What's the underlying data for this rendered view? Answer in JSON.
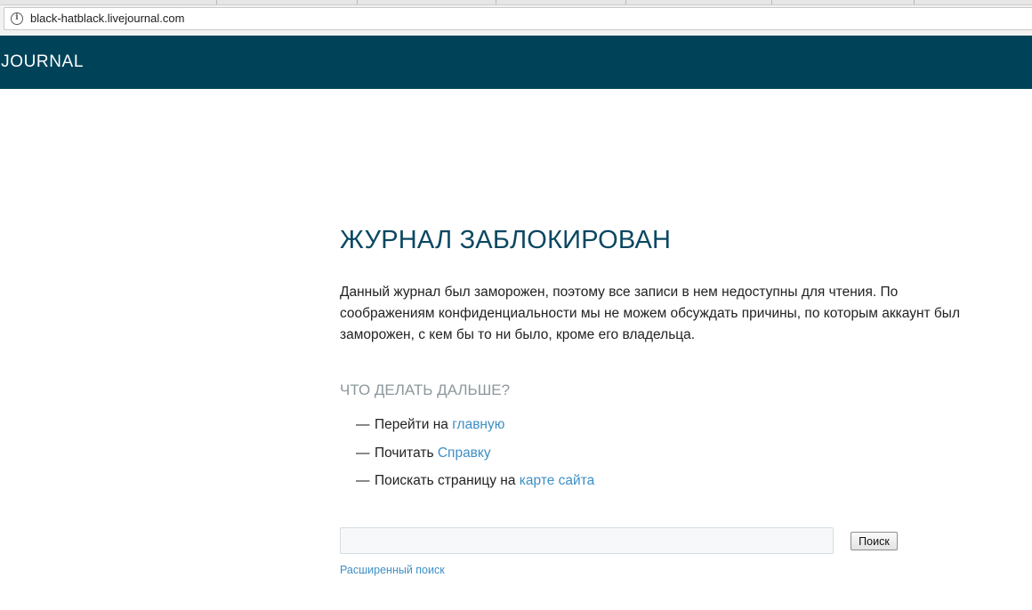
{
  "browser": {
    "url": "black-hatblack.livejournal.com",
    "info_icon": "info-icon"
  },
  "header": {
    "logo_text": "LIVEJOURNAL",
    "background_color": "#004359"
  },
  "main": {
    "title": "ЖУРНАЛ ЗАБЛОКИРОВАН",
    "description": "Данный журнал был заморожен, поэтому все записи в нем недоступны для чтения. По соображениям конфиденциальности мы не можем обсуждать причины, по которым аккаунт был заморожен, с кем бы то ни было, кроме его владельца.",
    "next_heading": "ЧТО ДЕЛАТЬ ДАЛЬШЕ?",
    "next_items": [
      {
        "dash": "—",
        "text": "Перейти на",
        "link": "главную"
      },
      {
        "dash": "—",
        "text": "Почитать",
        "link": "Справку"
      },
      {
        "dash": "—",
        "text": "Поискать страницу на",
        "link": "карте сайта"
      }
    ],
    "link_color": "#3d8fc5",
    "title_color": "#0b4761"
  },
  "search": {
    "value": "",
    "button_label": "Поиск",
    "advanced_label": "Расширенный поиск"
  }
}
